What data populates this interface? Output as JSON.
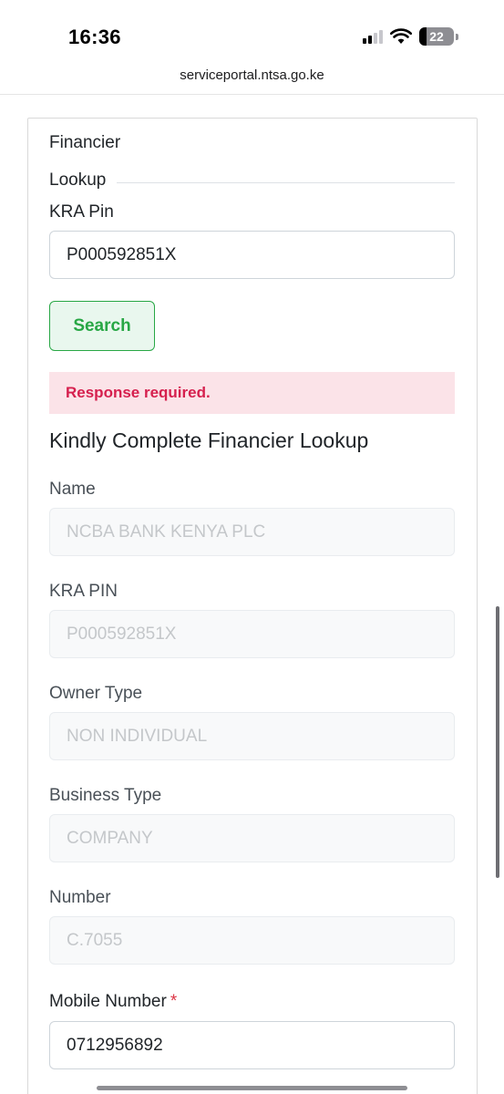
{
  "status_bar": {
    "time": "16:36",
    "battery": "22"
  },
  "browser": {
    "url": "serviceportal.ntsa.go.ke"
  },
  "form": {
    "section_title": "Financier",
    "legend": "Lookup",
    "kra_pin_label": "KRA Pin",
    "kra_pin_value": "P000592851X",
    "search_button": "Search",
    "alert_text": "Response required.",
    "subheading": "Kindly Complete Financier Lookup",
    "fields": [
      {
        "label": "Name",
        "value": "NCBA BANK KENYA PLC"
      },
      {
        "label": "KRA PIN",
        "value": "P000592851X"
      },
      {
        "label": "Owner Type",
        "value": "NON INDIVIDUAL"
      },
      {
        "label": "Business Type",
        "value": "COMPANY"
      },
      {
        "label": "Number",
        "value": "C.7055"
      }
    ],
    "mobile_label": "Mobile Number",
    "mobile_required": "*",
    "mobile_value": "0712956892"
  },
  "colors": {
    "success": "#28a745",
    "danger": "#dc3545",
    "alert_bg": "#fbe3e8"
  }
}
